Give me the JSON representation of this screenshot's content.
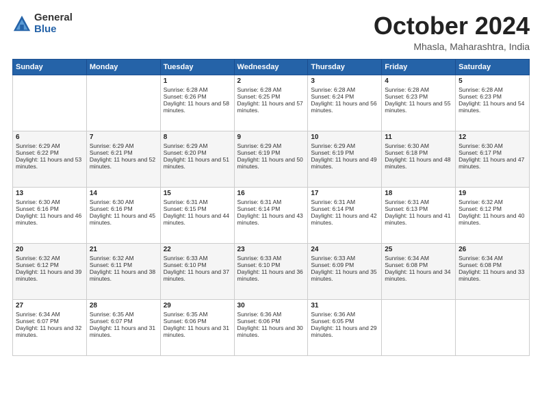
{
  "header": {
    "logo_general": "General",
    "logo_blue": "Blue",
    "month_title": "October 2024",
    "location": "Mhasla, Maharashtra, India"
  },
  "days_of_week": [
    "Sunday",
    "Monday",
    "Tuesday",
    "Wednesday",
    "Thursday",
    "Friday",
    "Saturday"
  ],
  "weeks": [
    [
      {
        "day": "",
        "sunrise": "",
        "sunset": "",
        "daylight": ""
      },
      {
        "day": "",
        "sunrise": "",
        "sunset": "",
        "daylight": ""
      },
      {
        "day": "1",
        "sunrise": "Sunrise: 6:28 AM",
        "sunset": "Sunset: 6:26 PM",
        "daylight": "Daylight: 11 hours and 58 minutes."
      },
      {
        "day": "2",
        "sunrise": "Sunrise: 6:28 AM",
        "sunset": "Sunset: 6:25 PM",
        "daylight": "Daylight: 11 hours and 57 minutes."
      },
      {
        "day": "3",
        "sunrise": "Sunrise: 6:28 AM",
        "sunset": "Sunset: 6:24 PM",
        "daylight": "Daylight: 11 hours and 56 minutes."
      },
      {
        "day": "4",
        "sunrise": "Sunrise: 6:28 AM",
        "sunset": "Sunset: 6:23 PM",
        "daylight": "Daylight: 11 hours and 55 minutes."
      },
      {
        "day": "5",
        "sunrise": "Sunrise: 6:28 AM",
        "sunset": "Sunset: 6:23 PM",
        "daylight": "Daylight: 11 hours and 54 minutes."
      }
    ],
    [
      {
        "day": "6",
        "sunrise": "Sunrise: 6:29 AM",
        "sunset": "Sunset: 6:22 PM",
        "daylight": "Daylight: 11 hours and 53 minutes."
      },
      {
        "day": "7",
        "sunrise": "Sunrise: 6:29 AM",
        "sunset": "Sunset: 6:21 PM",
        "daylight": "Daylight: 11 hours and 52 minutes."
      },
      {
        "day": "8",
        "sunrise": "Sunrise: 6:29 AM",
        "sunset": "Sunset: 6:20 PM",
        "daylight": "Daylight: 11 hours and 51 minutes."
      },
      {
        "day": "9",
        "sunrise": "Sunrise: 6:29 AM",
        "sunset": "Sunset: 6:19 PM",
        "daylight": "Daylight: 11 hours and 50 minutes."
      },
      {
        "day": "10",
        "sunrise": "Sunrise: 6:29 AM",
        "sunset": "Sunset: 6:19 PM",
        "daylight": "Daylight: 11 hours and 49 minutes."
      },
      {
        "day": "11",
        "sunrise": "Sunrise: 6:30 AM",
        "sunset": "Sunset: 6:18 PM",
        "daylight": "Daylight: 11 hours and 48 minutes."
      },
      {
        "day": "12",
        "sunrise": "Sunrise: 6:30 AM",
        "sunset": "Sunset: 6:17 PM",
        "daylight": "Daylight: 11 hours and 47 minutes."
      }
    ],
    [
      {
        "day": "13",
        "sunrise": "Sunrise: 6:30 AM",
        "sunset": "Sunset: 6:16 PM",
        "daylight": "Daylight: 11 hours and 46 minutes."
      },
      {
        "day": "14",
        "sunrise": "Sunrise: 6:30 AM",
        "sunset": "Sunset: 6:16 PM",
        "daylight": "Daylight: 11 hours and 45 minutes."
      },
      {
        "day": "15",
        "sunrise": "Sunrise: 6:31 AM",
        "sunset": "Sunset: 6:15 PM",
        "daylight": "Daylight: 11 hours and 44 minutes."
      },
      {
        "day": "16",
        "sunrise": "Sunrise: 6:31 AM",
        "sunset": "Sunset: 6:14 PM",
        "daylight": "Daylight: 11 hours and 43 minutes."
      },
      {
        "day": "17",
        "sunrise": "Sunrise: 6:31 AM",
        "sunset": "Sunset: 6:14 PM",
        "daylight": "Daylight: 11 hours and 42 minutes."
      },
      {
        "day": "18",
        "sunrise": "Sunrise: 6:31 AM",
        "sunset": "Sunset: 6:13 PM",
        "daylight": "Daylight: 11 hours and 41 minutes."
      },
      {
        "day": "19",
        "sunrise": "Sunrise: 6:32 AM",
        "sunset": "Sunset: 6:12 PM",
        "daylight": "Daylight: 11 hours and 40 minutes."
      }
    ],
    [
      {
        "day": "20",
        "sunrise": "Sunrise: 6:32 AM",
        "sunset": "Sunset: 6:12 PM",
        "daylight": "Daylight: 11 hours and 39 minutes."
      },
      {
        "day": "21",
        "sunrise": "Sunrise: 6:32 AM",
        "sunset": "Sunset: 6:11 PM",
        "daylight": "Daylight: 11 hours and 38 minutes."
      },
      {
        "day": "22",
        "sunrise": "Sunrise: 6:33 AM",
        "sunset": "Sunset: 6:10 PM",
        "daylight": "Daylight: 11 hours and 37 minutes."
      },
      {
        "day": "23",
        "sunrise": "Sunrise: 6:33 AM",
        "sunset": "Sunset: 6:10 PM",
        "daylight": "Daylight: 11 hours and 36 minutes."
      },
      {
        "day": "24",
        "sunrise": "Sunrise: 6:33 AM",
        "sunset": "Sunset: 6:09 PM",
        "daylight": "Daylight: 11 hours and 35 minutes."
      },
      {
        "day": "25",
        "sunrise": "Sunrise: 6:34 AM",
        "sunset": "Sunset: 6:08 PM",
        "daylight": "Daylight: 11 hours and 34 minutes."
      },
      {
        "day": "26",
        "sunrise": "Sunrise: 6:34 AM",
        "sunset": "Sunset: 6:08 PM",
        "daylight": "Daylight: 11 hours and 33 minutes."
      }
    ],
    [
      {
        "day": "27",
        "sunrise": "Sunrise: 6:34 AM",
        "sunset": "Sunset: 6:07 PM",
        "daylight": "Daylight: 11 hours and 32 minutes."
      },
      {
        "day": "28",
        "sunrise": "Sunrise: 6:35 AM",
        "sunset": "Sunset: 6:07 PM",
        "daylight": "Daylight: 11 hours and 31 minutes."
      },
      {
        "day": "29",
        "sunrise": "Sunrise: 6:35 AM",
        "sunset": "Sunset: 6:06 PM",
        "daylight": "Daylight: 11 hours and 31 minutes."
      },
      {
        "day": "30",
        "sunrise": "Sunrise: 6:36 AM",
        "sunset": "Sunset: 6:06 PM",
        "daylight": "Daylight: 11 hours and 30 minutes."
      },
      {
        "day": "31",
        "sunrise": "Sunrise: 6:36 AM",
        "sunset": "Sunset: 6:05 PM",
        "daylight": "Daylight: 11 hours and 29 minutes."
      },
      {
        "day": "",
        "sunrise": "",
        "sunset": "",
        "daylight": ""
      },
      {
        "day": "",
        "sunrise": "",
        "sunset": "",
        "daylight": ""
      }
    ]
  ]
}
